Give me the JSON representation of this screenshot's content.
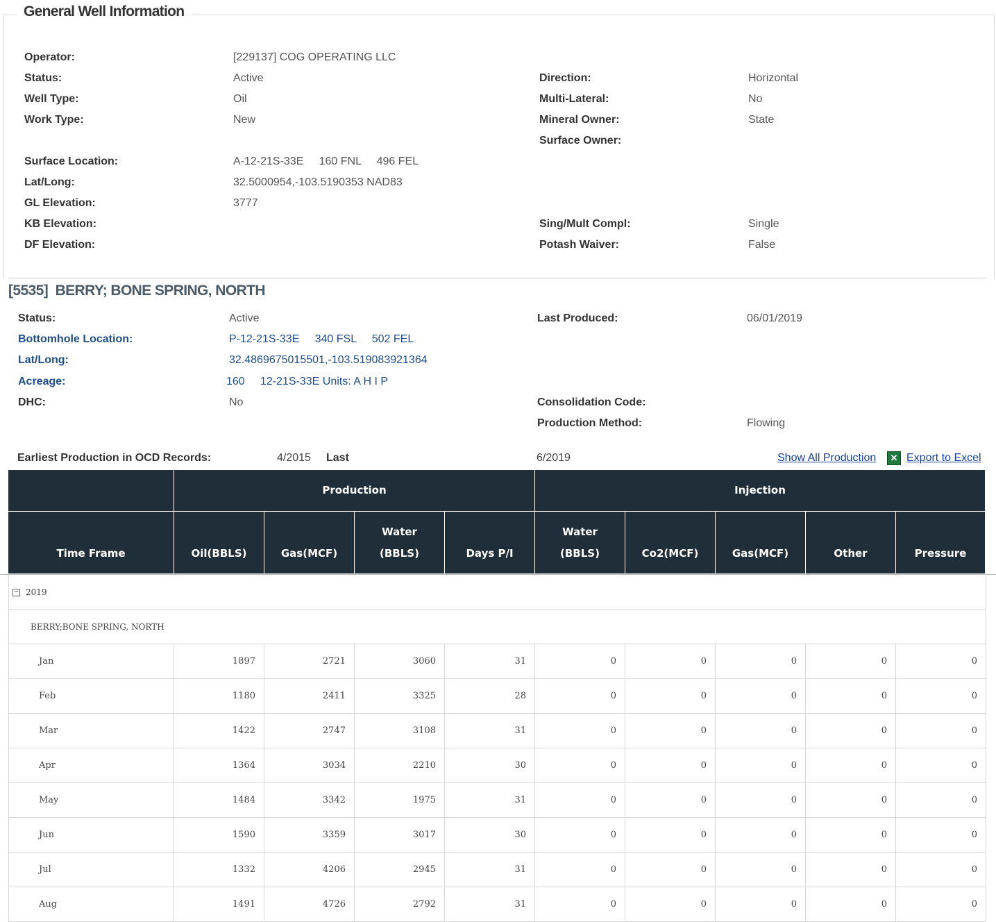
{
  "general": {
    "title": "General Well Information",
    "left": [
      {
        "label": "Operator:",
        "value": "[229137] COG OPERATING LLC"
      },
      {
        "label": "Status:",
        "value": "Active"
      },
      {
        "label": "Well Type:",
        "value": "Oil"
      },
      {
        "label": "Work Type:",
        "value": "New"
      },
      {
        "label": "Surface Location:",
        "value": "A-12-21S-33E     160 FNL     496 FEL"
      },
      {
        "label": "Lat/Long:",
        "value": "32.5000954,-103.5190353 NAD83"
      },
      {
        "label": "GL Elevation:",
        "value": "3777"
      },
      {
        "label": "KB Elevation:",
        "value": ""
      },
      {
        "label": "DF Elevation:",
        "value": ""
      }
    ],
    "right": [
      {
        "label": "Direction:",
        "value": "Horizontal"
      },
      {
        "label": "Multi-Lateral:",
        "value": "No"
      },
      {
        "label": "Mineral Owner:",
        "value": "State"
      },
      {
        "label": "Surface Owner:",
        "value": ""
      },
      {
        "label": "Sing/Mult Compl:",
        "value": "Single"
      },
      {
        "label": "Potash Waiver:",
        "value": "False"
      }
    ]
  },
  "pool": {
    "title": "[5535]  BERRY; BONE SPRING, NORTH",
    "left": [
      {
        "label": "Status:",
        "value": "Active"
      },
      {
        "label": "Bottomhole Location:",
        "value": "P-12-21S-33E     340 FSL     502 FEL"
      },
      {
        "label": "Lat/Long:",
        "value": "32.4869675015501,-103.519083921364"
      },
      {
        "label": "Acreage:",
        "value": "160     12-21S-33E Units: A H I P"
      },
      {
        "label": "DHC:",
        "value": "No"
      }
    ],
    "right": [
      {
        "label": "Last Produced:",
        "value": "06/01/2019"
      },
      {
        "label": "Consolidation Code:",
        "value": ""
      },
      {
        "label": "Production Method:",
        "value": "Flowing"
      }
    ]
  },
  "summary": {
    "earliest_label": "Earliest Production in OCD Records:",
    "earliest_value": "4/2015",
    "last_label": "Last",
    "last_value": "6/2019",
    "show_all": "Show All Production",
    "export": "Export to Excel",
    "excel_icon": "excel-icon"
  },
  "table": {
    "group_headers": {
      "production": "Production",
      "injection": "Injection"
    },
    "columns": [
      [
        "Time Frame"
      ],
      [
        "Oil(BBLS)"
      ],
      [
        "Gas(MCF)"
      ],
      [
        "Water",
        "(BBLS)"
      ],
      [
        "Days P/I"
      ],
      [
        "Water",
        "(BBLS)"
      ],
      [
        "Co2(MCF)"
      ],
      [
        "Gas(MCF)"
      ],
      [
        "Other"
      ],
      [
        "Pressure"
      ]
    ],
    "year": "2019",
    "pool_name": "BERRY;BONE SPRING, NORTH",
    "rows": [
      [
        "Jan",
        "1897",
        "2721",
        "3060",
        "31",
        "0",
        "0",
        "0",
        "0",
        "0"
      ],
      [
        "Feb",
        "1180",
        "2411",
        "3325",
        "28",
        "0",
        "0",
        "0",
        "0",
        "0"
      ],
      [
        "Mar",
        "1422",
        "2747",
        "3108",
        "31",
        "0",
        "0",
        "0",
        "0",
        "0"
      ],
      [
        "Apr",
        "1364",
        "3034",
        "2210",
        "30",
        "0",
        "0",
        "0",
        "0",
        "0"
      ],
      [
        "May",
        "1484",
        "3342",
        "1975",
        "31",
        "0",
        "0",
        "0",
        "0",
        "0"
      ],
      [
        "Jun",
        "1590",
        "3359",
        "3017",
        "30",
        "0",
        "0",
        "0",
        "0",
        "0"
      ],
      [
        "Jul",
        "1332",
        "4206",
        "2945",
        "31",
        "0",
        "0",
        "0",
        "0",
        "0"
      ],
      [
        "Aug",
        "1491",
        "4726",
        "2792",
        "31",
        "0",
        "0",
        "0",
        "0",
        "0"
      ]
    ]
  },
  "colors": {
    "header_bg": "#1f2e38",
    "link": "#1a3f9c",
    "blue_label": "#1f4e8c"
  }
}
